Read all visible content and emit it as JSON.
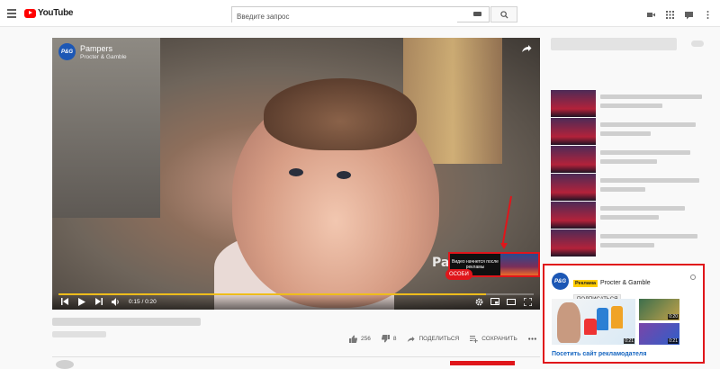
{
  "header": {
    "logo_text": "YouTube",
    "search_placeholder": "Введите запрос"
  },
  "player": {
    "channel_title": "Pampers",
    "channel_sub": "Procter & Gamble",
    "avatar_text": "P&G",
    "brand_watermark": "Pam",
    "ad_preview_text": "Видео начнется после рекламы",
    "pill_text": "ОСОБИ",
    "time": "0:15 / 0:20",
    "progress_fraction": 0.9
  },
  "below_video": {
    "likes": "256",
    "dislikes": "8",
    "share_label": "ПОДЕЛИТЬСЯ",
    "save_label": "СОХРАНИТЬ"
  },
  "ad_card": {
    "logo_text": "P&G",
    "badge": "Реклама",
    "advertiser": "Procter & Gamble",
    "subscribe_label": "ПОДПИСАТЬСЯ",
    "durations": [
      "0:20",
      "0:21",
      "0:21"
    ],
    "link_text": "Посетить сайт рекламодателя"
  },
  "colors": {
    "brand_red": "#ff0000",
    "highlight_red": "#e0161b",
    "progress_yellow": "#f6c21c",
    "ad_badge_yellow": "#ffcc00"
  }
}
